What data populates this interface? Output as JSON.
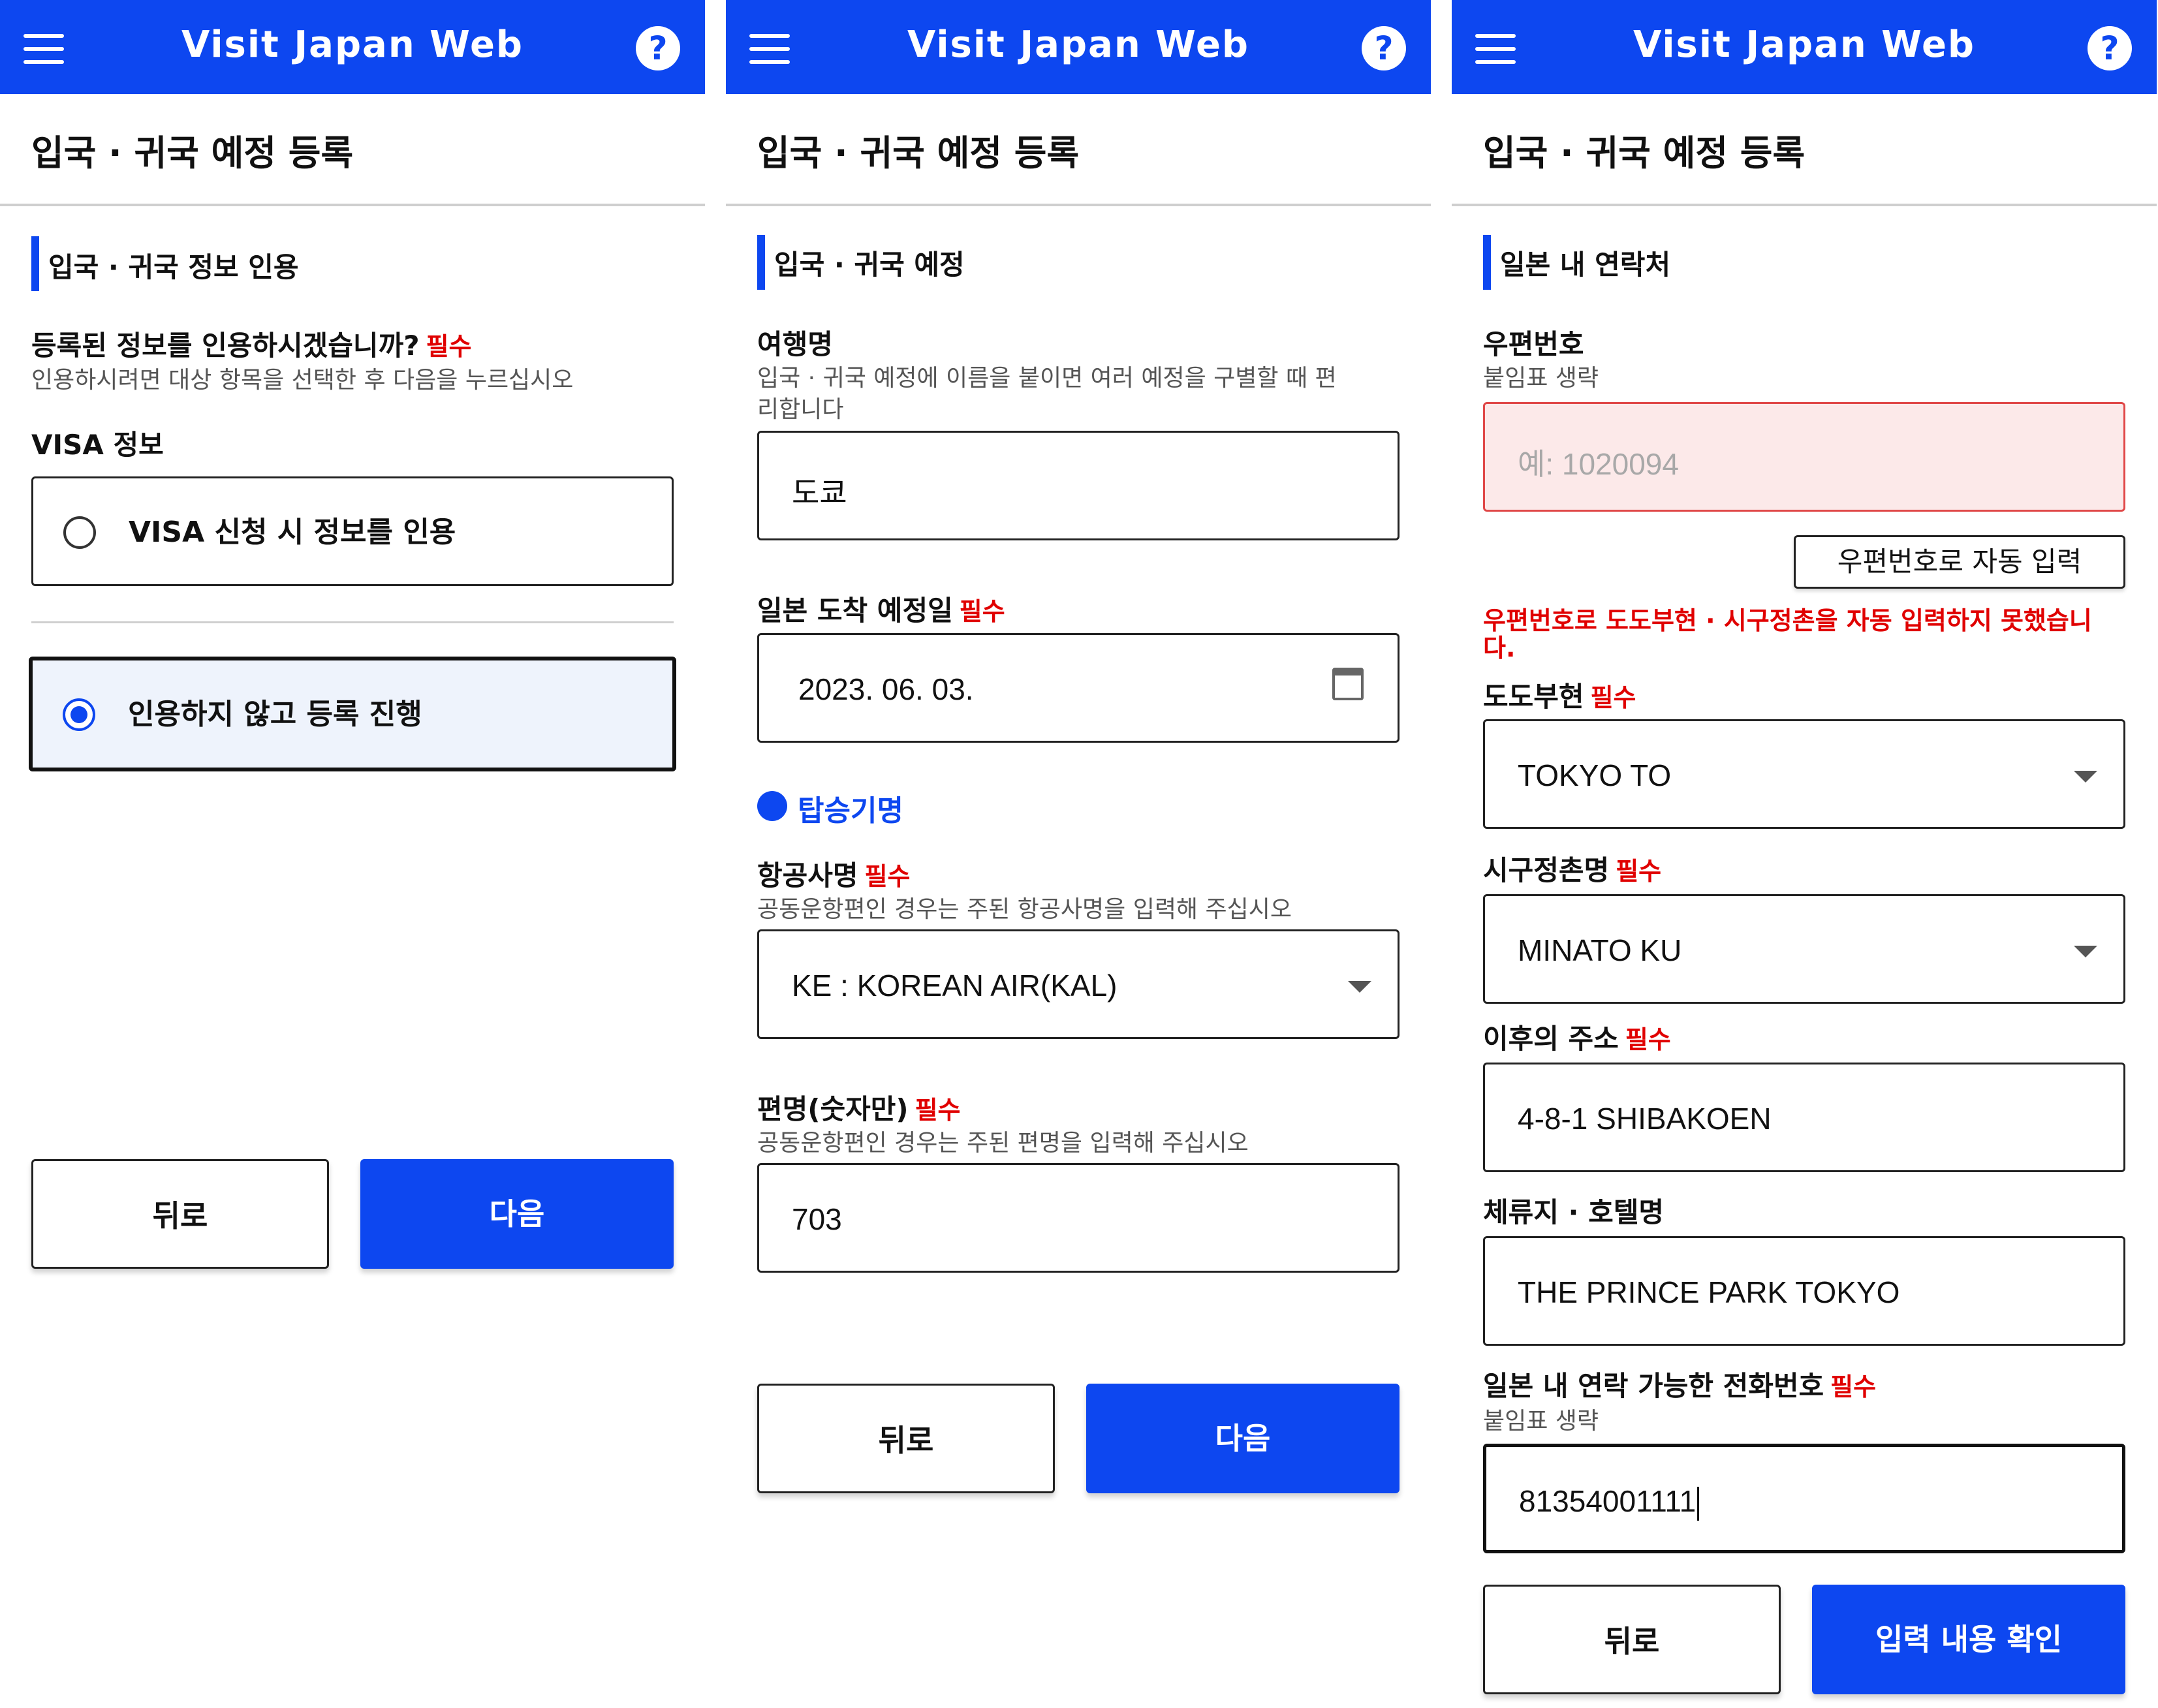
{
  "app": {
    "title": "Visit Japan Web",
    "help_glyph": "?",
    "accent": "#0D47F0",
    "required_color": "#E00000"
  },
  "page_title": "입국 · 귀국 예정 등록",
  "required_label": "필수",
  "screen1": {
    "section_title": "입국 · 귀국 정보 인용",
    "question": "등록된 정보를 인용하시겠습니까?",
    "question_hint": "인용하시려면 대상 항목을 선택한 후 다음을 누르십시오",
    "visa_label": "VISA 정보",
    "options": [
      {
        "label": "VISA 신청 시 정보를 인용",
        "selected": false
      },
      {
        "label": "인용하지 않고 등록 진행",
        "selected": true
      }
    ],
    "back_label": "뒤로",
    "next_label": "다음"
  },
  "screen2": {
    "section_title": "입국 · 귀국 예정",
    "trip_name_label": "여행명",
    "trip_name_hint_1": "입국 · 귀국 예정에 이름을 붙이면 여러 예정을 구별할 때 편",
    "trip_name_hint_2": "리합니다",
    "trip_name_value": "도쿄",
    "arrival_date_label": "일본 도착 예정일",
    "arrival_date_value": "2023. 06. 03.",
    "flight_section_title": "탑승기명",
    "airline_label": "항공사명",
    "airline_hint": "공동운항편인 경우는 주된 항공사명을 입력해 주십시오",
    "airline_value": "KE : KOREAN AIR(KAL)",
    "flight_no_label": "편명(숫자만)",
    "flight_no_hint": "공동운항편인 경우는 주된 편명을 입력해 주십시오",
    "flight_no_value": "703",
    "back_label": "뒤로",
    "next_label": "다음"
  },
  "screen3": {
    "section_title": "일본 내 연락처",
    "postal_label": "우편번호",
    "postal_hint": "붙임표 생략",
    "postal_placeholder": "예: 1020094",
    "autofill_button": "우편번호로 자동 입력",
    "error_1": "우편번호로 도도부현 · 시구정촌을 자동 입력하지 못했습니",
    "error_2": "다.",
    "prefecture_label": "도도부현",
    "prefecture_value": "TOKYO TO",
    "city_label": "시구정촌명",
    "city_value": "MINATO KU",
    "address_label": "이후의 주소",
    "address_value": "4-8-1 SHIBAKOEN",
    "hotel_label": "체류지 · 호텔명",
    "hotel_value": "THE PRINCE PARK TOKYO",
    "phone_label": "일본 내 연락 가능한 전화번호",
    "phone_hint": "붙임표 생략",
    "phone_value": "81354001111",
    "back_label": "뒤로",
    "confirm_label": "입력 내용 확인"
  }
}
